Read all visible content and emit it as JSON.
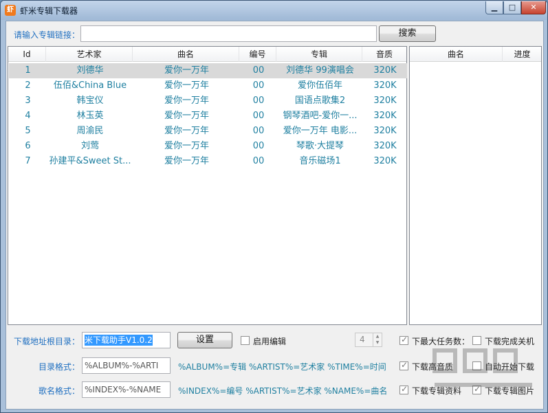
{
  "window": {
    "title": "虾米专辑下载器",
    "app_icon_text": "虾",
    "min": "▁",
    "max": "□",
    "close": "✕"
  },
  "search": {
    "label": "请输入专辑链接：",
    "value": "",
    "button": "搜索"
  },
  "tracks": {
    "columns": [
      "Id",
      "艺术家",
      "曲名",
      "编号",
      "专辑",
      "音质"
    ],
    "rows": [
      {
        "id": "1",
        "artist": "刘德华",
        "song": "爱你一万年",
        "num": "00",
        "album": "刘德华 99演唱会",
        "quality": "320K"
      },
      {
        "id": "2",
        "artist": "伍佰&China Blue",
        "song": "爱你一万年",
        "num": "00",
        "album": "爱你伍佰年",
        "quality": "320K"
      },
      {
        "id": "3",
        "artist": "韩宝仪",
        "song": "爱你一万年",
        "num": "00",
        "album": "国语点歌集2",
        "quality": "320K"
      },
      {
        "id": "4",
        "artist": "林玉英",
        "song": "爱你一万年",
        "num": "00",
        "album": "钢琴酒吧-爱你一...",
        "quality": "320K"
      },
      {
        "id": "5",
        "artist": "周渝民",
        "song": "爱你一万年",
        "num": "00",
        "album": "爱你一万年 电影...",
        "quality": "320K"
      },
      {
        "id": "6",
        "artist": "刘莺",
        "song": "爱你一万年",
        "num": "00",
        "album": "琴歌·大提琴",
        "quality": "320K"
      },
      {
        "id": "7",
        "artist": "孙建平&Sweet St...",
        "song": "爱你一万年",
        "num": "00",
        "album": "音乐磁场1",
        "quality": "320K"
      }
    ]
  },
  "downloads": {
    "columns": [
      "曲名",
      "进度"
    ]
  },
  "settings": {
    "root_label": "下载地址根目录：",
    "root_value": "米下载助手V1.0.2",
    "set_button": "设置",
    "enable_edit": "启用编辑",
    "max_tasks_value": "4",
    "max_tasks_label": "下最大任务数：",
    "shutdown_label": "下载完成关机",
    "dir_format_label": "目录格式：",
    "dir_format_value": "%ALBUM%-%ARTI",
    "dir_format_hint": "%ALBUM%=专辑 %ARTIST%=艺术家 %TIME%=时间",
    "hq_label": "下载高音质",
    "autostart_label": "自动开始下载",
    "name_format_label": "歌名格式：",
    "name_format_value": "%INDEX%-%NAME",
    "name_format_hint": "%INDEX%=编号 %ARTIST%=艺术家 %NAME%=曲名",
    "album_info_label": "下载专辑资料",
    "album_pic_label": "下载专辑图片"
  }
}
